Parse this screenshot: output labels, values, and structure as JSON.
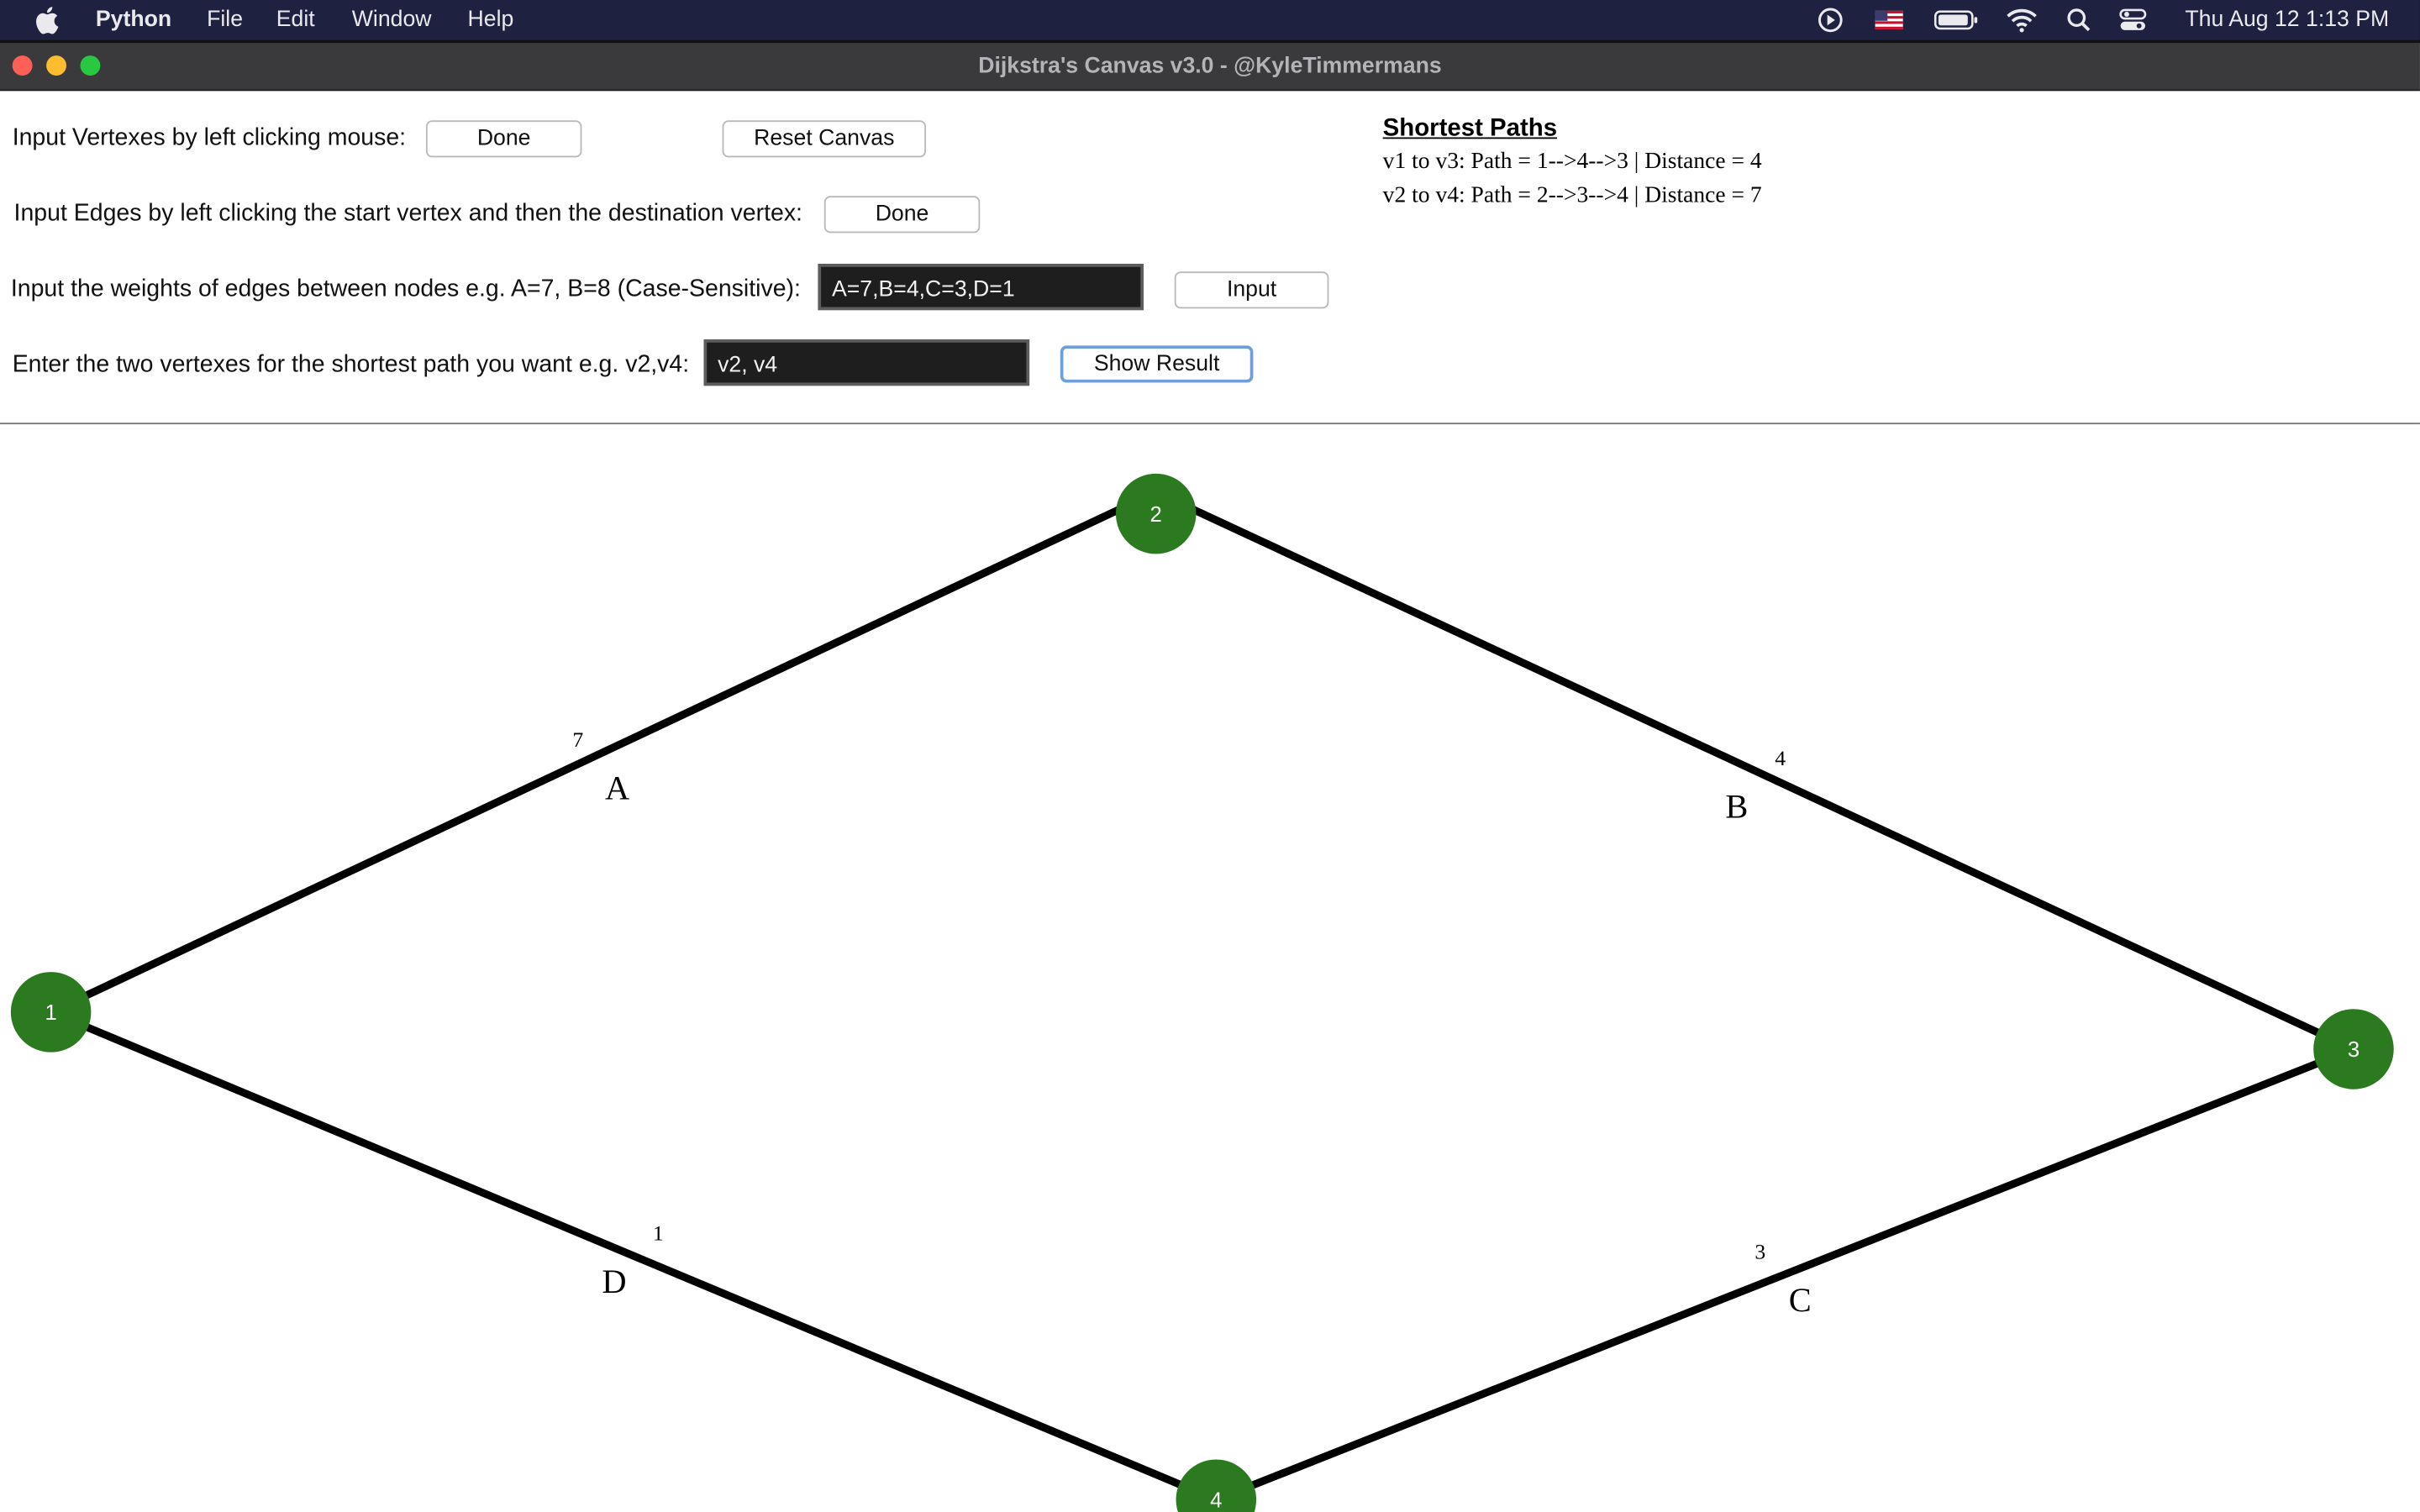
{
  "menubar": {
    "app_name": "Python",
    "items": [
      "File",
      "Edit",
      "Window",
      "Help"
    ],
    "clock": "Thu Aug 12  1:13 PM"
  },
  "window": {
    "title": "Dijkstra's Canvas v3.0 - @KyleTimmermans"
  },
  "controls": {
    "vertex_label": "Input Vertexes by left clicking mouse:",
    "vertex_done": "Done",
    "reset_canvas": "Reset Canvas",
    "edge_label": "Input Edges by left clicking the start vertex and then the destination vertex:",
    "edge_done": "Done",
    "weights_label": "Input the weights of edges between nodes e.g. A=7, B=8 (Case-Sensitive):",
    "weights_value": "A=7,B=4,C=3,D=1",
    "weights_button": "Input",
    "path_label": "Enter the two vertexes for the shortest path you want e.g. v2,v4:",
    "path_value": "v2, v4",
    "show_result": "Show Result"
  },
  "shortest_paths": {
    "title": "Shortest Paths",
    "results": [
      "v1 to v3: Path = 1-->4-->3 | Distance = 4",
      "v2 to v4: Path = 2-->3-->4 | Distance = 7"
    ]
  },
  "graph": {
    "nodes": [
      "1",
      "2",
      "3",
      "4"
    ],
    "edges": [
      {
        "name": "A",
        "from": "1",
        "to": "2",
        "weight": "7"
      },
      {
        "name": "B",
        "from": "2",
        "to": "3",
        "weight": "4"
      },
      {
        "name": "C",
        "from": "3",
        "to": "4",
        "weight": "3"
      },
      {
        "name": "D",
        "from": "4",
        "to": "1",
        "weight": "1"
      }
    ],
    "node_color": "#2c7a20"
  },
  "icons": {
    "apple": "apple-icon",
    "status": [
      "play-circle-icon",
      "us-flag-icon",
      "battery-icon",
      "wifi-icon",
      "search-icon",
      "control-center-icon"
    ]
  }
}
